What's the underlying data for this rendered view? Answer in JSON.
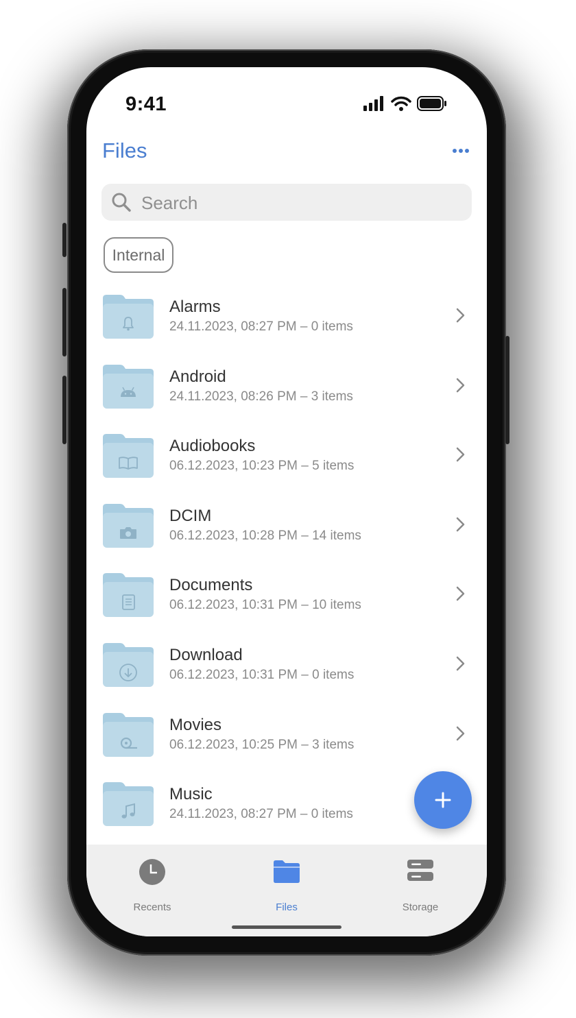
{
  "status_bar": {
    "time": "9:41"
  },
  "header": {
    "title": "Files",
    "more_icon": "more-horizontal-icon"
  },
  "search": {
    "placeholder": "Search"
  },
  "filter_chip": {
    "label": "Internal"
  },
  "folders": [
    {
      "name": "Alarms",
      "meta": "24.11.2023, 08:27 PM – 0 items",
      "icon": "bell-icon"
    },
    {
      "name": "Android",
      "meta": "24.11.2023, 08:26 PM – 3 items",
      "icon": "android-icon"
    },
    {
      "name": "Audiobooks",
      "meta": "06.12.2023, 10:23 PM – 5 items",
      "icon": "book-icon"
    },
    {
      "name": "DCIM",
      "meta": "06.12.2023, 10:28 PM – 14 items",
      "icon": "camera-icon"
    },
    {
      "name": "Documents",
      "meta": "06.12.2023, 10:31 PM – 10 items",
      "icon": "document-icon"
    },
    {
      "name": "Download",
      "meta": "06.12.2023, 10:31 PM – 0 items",
      "icon": "download-icon"
    },
    {
      "name": "Movies",
      "meta": "06.12.2023, 10:25 PM – 3 items",
      "icon": "film-reel-icon"
    },
    {
      "name": "Music",
      "meta": "24.11.2023, 08:27 PM – 0 items",
      "icon": "music-note-icon"
    }
  ],
  "fab": {
    "icon": "plus-icon"
  },
  "tabbar": {
    "tabs": [
      {
        "label": "Recents",
        "icon": "clock-icon",
        "active": false
      },
      {
        "label": "Files",
        "icon": "folder-icon",
        "active": true
      },
      {
        "label": "Storage",
        "icon": "storage-icon",
        "active": false
      }
    ]
  },
  "colors": {
    "accent": "#4a7ed0",
    "fab": "#4f86e5",
    "folder": "#bcd9e8",
    "folder_tab": "#a9cde1",
    "inactive_tab": "#7b7b7b"
  }
}
